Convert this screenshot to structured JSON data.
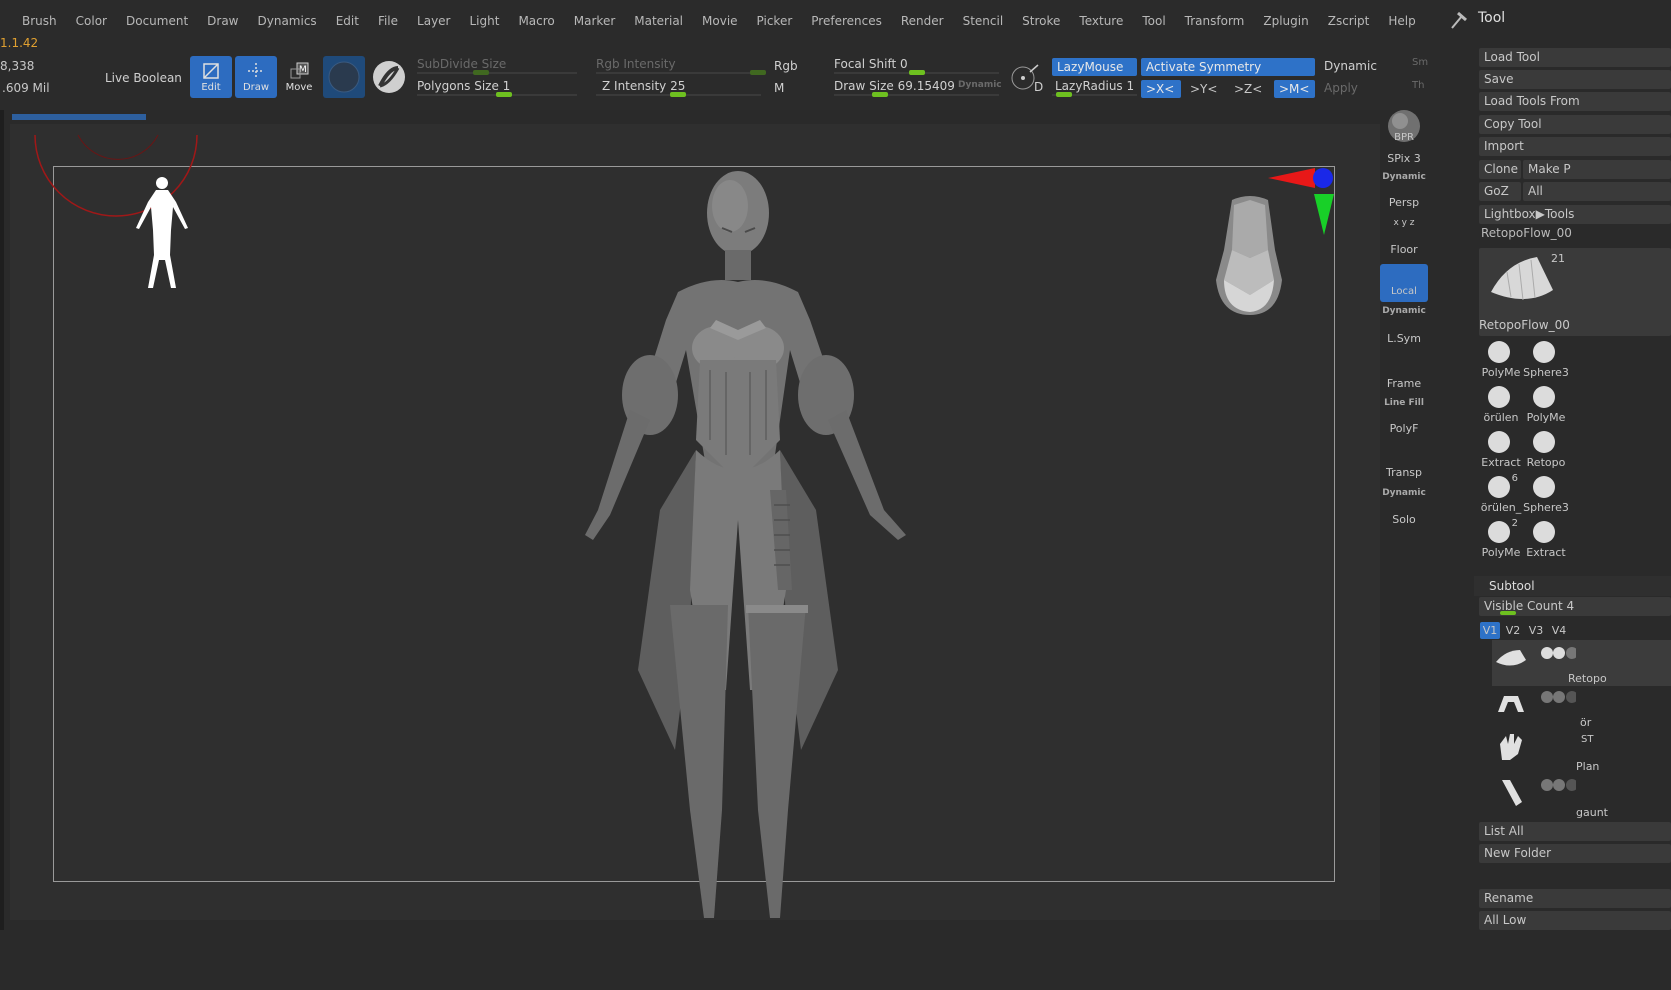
{
  "menubar": {
    "items": [
      "Brush",
      "Color",
      "Document",
      "Draw",
      "Dynamics",
      "Edit",
      "File",
      "Layer",
      "Light",
      "Macro",
      "Marker",
      "Material",
      "Movie",
      "Picker",
      "Preferences",
      "Render",
      "Stencil",
      "Stroke",
      "Texture",
      "Tool",
      "Transform",
      "Zplugin",
      "Zscript",
      "Help"
    ]
  },
  "stats": {
    "version": "1.1.42",
    "points": "8,338",
    "poly": ".609 Mil"
  },
  "toolbar": {
    "live_boolean": "Live Boolean",
    "edit": "Edit",
    "draw": "Draw",
    "move": "Move",
    "subdivide_size": "SubDivide Size",
    "polygons_size": "Polygons Size 1",
    "rgb_intensity": "Rgb Intensity",
    "rgb": "Rgb",
    "m": "M",
    "z_intensity": "Z Intensity 25",
    "focal_shift": "Focal Shift 0",
    "draw_size": "Draw Size 69.15409",
    "dynamic_small": "Dynamic",
    "d": "D",
    "lazymouse": "LazyMouse",
    "lazyradius": "LazyRadius 1",
    "activate_symmetry": "Activate Symmetry",
    "dynamic": "Dynamic",
    "sym_x": ">X<",
    "sym_y": ">Y<",
    "sym_z": ">Z<",
    "sym_m": ">M<",
    "apply": "Apply",
    "sm": "Sm",
    "th": "Th"
  },
  "shelf": {
    "bpr": "BPR",
    "spix": "SPix 3",
    "dynamic_persp": "Dynamic",
    "persp": "Persp",
    "xyz": "x y z",
    "floor": "Floor",
    "local": "Local",
    "dynamic_lsym": "Dynamic",
    "lsym": "L.Sym",
    "frame": "Frame",
    "line_fill": "Line Fill",
    "polyf": "PolyF",
    "transp": "Transp",
    "dynamic_solo": "Dynamic",
    "solo": "Solo"
  },
  "tool_panel": {
    "title": "Tool",
    "load_tool": "Load Tool",
    "save": "Save",
    "load_from": "Load Tools From",
    "copy_tool": "Copy Tool",
    "import": "Import",
    "clone": "Clone",
    "make_p": "Make P",
    "goz": "GoZ",
    "all": "All",
    "lightbox": "Lightbox▶Tools",
    "current_tool": "RetopoFlow_00",
    "current_count": "21",
    "current_caption": "RetopoFlow_00",
    "thumbs": [
      {
        "label": "PolyMe",
        "badge": ""
      },
      {
        "label": "Sphere3",
        "badge": ""
      },
      {
        "label": "örülen",
        "badge": ""
      },
      {
        "label": "PolyMe",
        "badge": ""
      },
      {
        "label": "Extract",
        "badge": ""
      },
      {
        "label": "Retopo",
        "badge": ""
      },
      {
        "label": "örülen_",
        "badge": "6"
      },
      {
        "label": "Sphere3",
        "badge": ""
      },
      {
        "label": "PolyMe",
        "badge": "2"
      },
      {
        "label": "Extract",
        "badge": ""
      }
    ],
    "subtool_title": "Subtool",
    "visible_count": "Visible Count 4",
    "v_tabs": [
      "V1",
      "V2",
      "V3",
      "V4"
    ],
    "subtools": [
      "Retopo",
      "ör",
      "Plan",
      "gaunt"
    ],
    "st_mark": "ST",
    "list_all": "List All",
    "new_folder": "New Folder",
    "rename": "Rename",
    "all_low": "All Low"
  }
}
